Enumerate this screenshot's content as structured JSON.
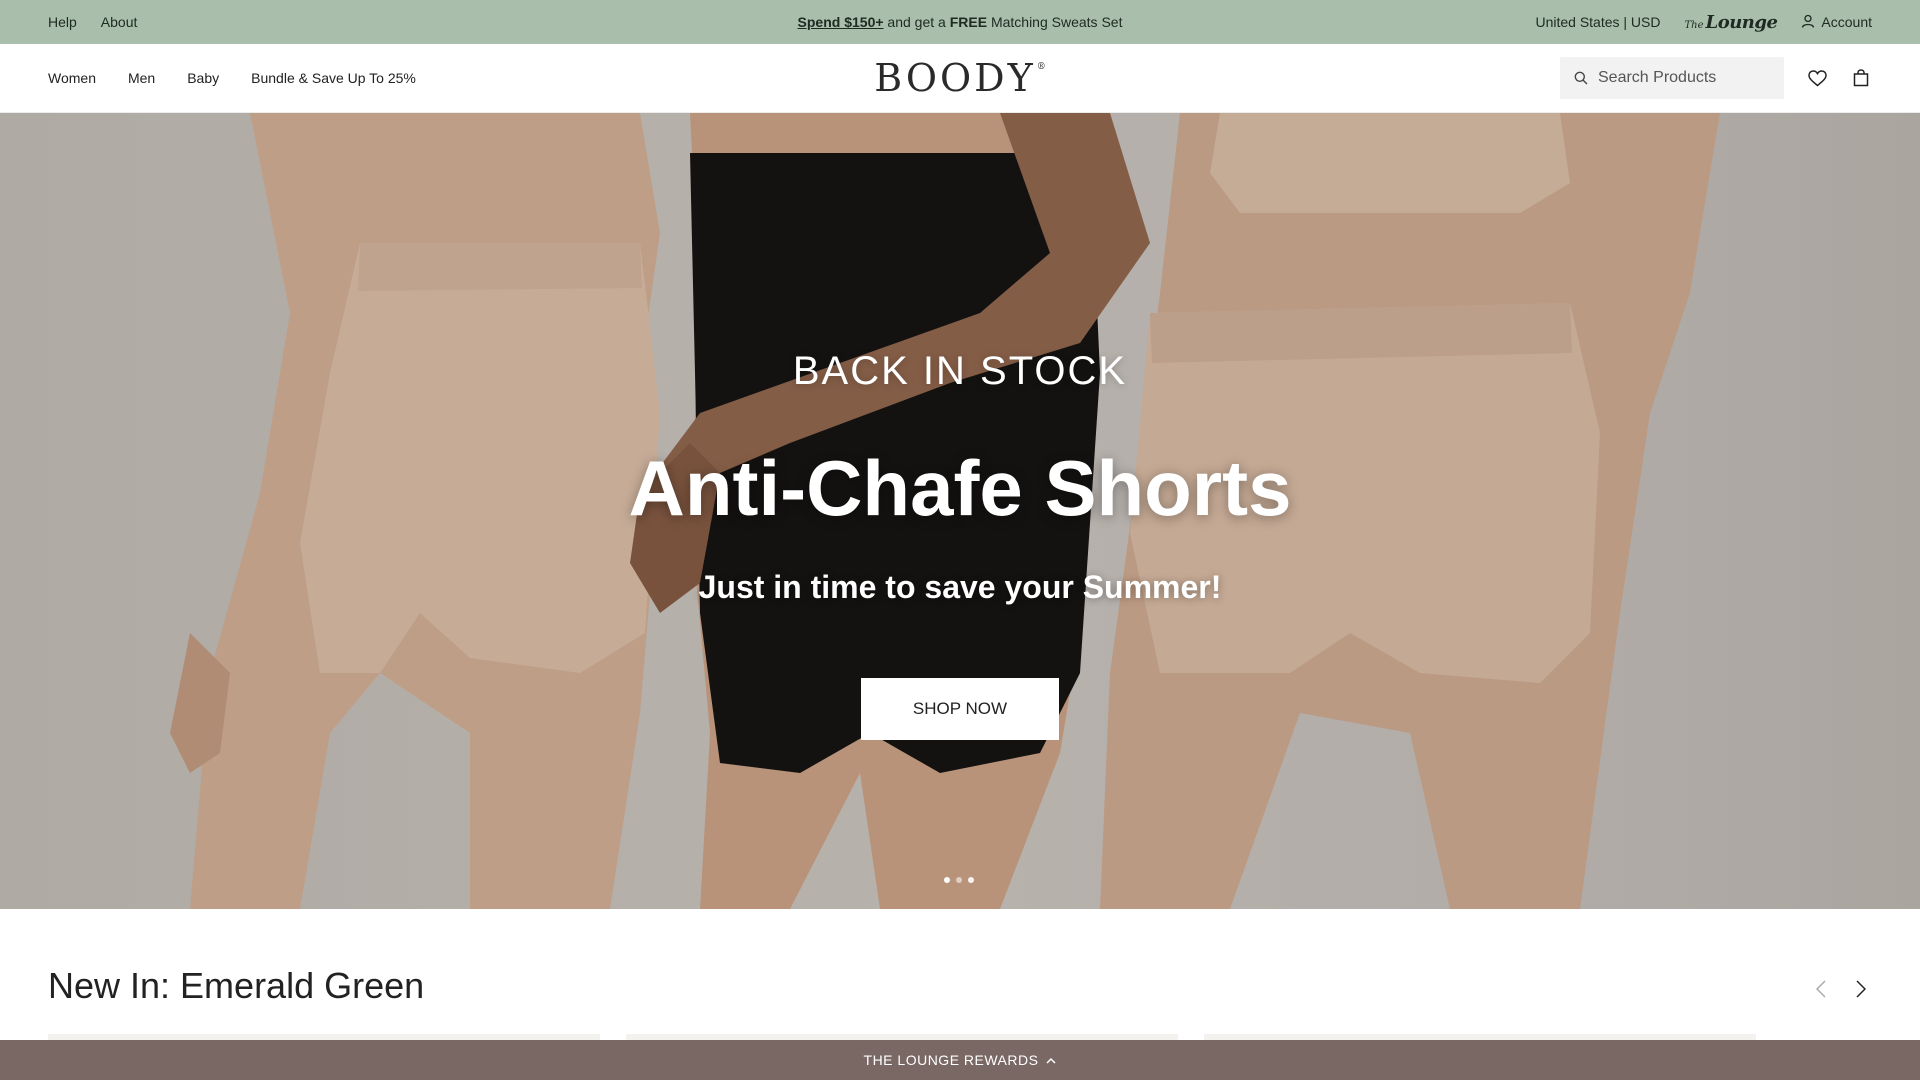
{
  "announcement": {
    "help": "Help",
    "about": "About",
    "promo_spend": "Spend $150+",
    "promo_mid": " and get a ",
    "promo_free": "FREE",
    "promo_end": " Matching Sweats Set",
    "region": "United States | USD",
    "lounge_the": "The",
    "lounge_name": "Lounge",
    "account": "Account"
  },
  "nav": {
    "items": [
      "Women",
      "Men",
      "Baby",
      "Bundle & Save Up To 25%"
    ]
  },
  "logo": {
    "text": "BOODY",
    "mark": "®"
  },
  "search": {
    "placeholder": "Search Products"
  },
  "hero": {
    "eyebrow": "BACK IN STOCK",
    "headline": "Anti-Chafe Shorts",
    "subhead": "Just in time to save your Summer!",
    "cta": "SHOP NOW",
    "slide_count": 3,
    "active_slide": 1
  },
  "section": {
    "title": "New In: Emerald Green"
  },
  "rewards": {
    "label": "THE LOUNGE REWARDS"
  },
  "colors": {
    "announce_bg": "#a9bfab",
    "rewards_bg": "#7a6864",
    "skin": "#c9a58a",
    "black_garment": "#151312"
  },
  "icons": [
    "search-icon",
    "heart-icon",
    "bag-icon",
    "user-icon",
    "chevron-up-icon",
    "chevron-left-icon",
    "chevron-right-icon"
  ]
}
